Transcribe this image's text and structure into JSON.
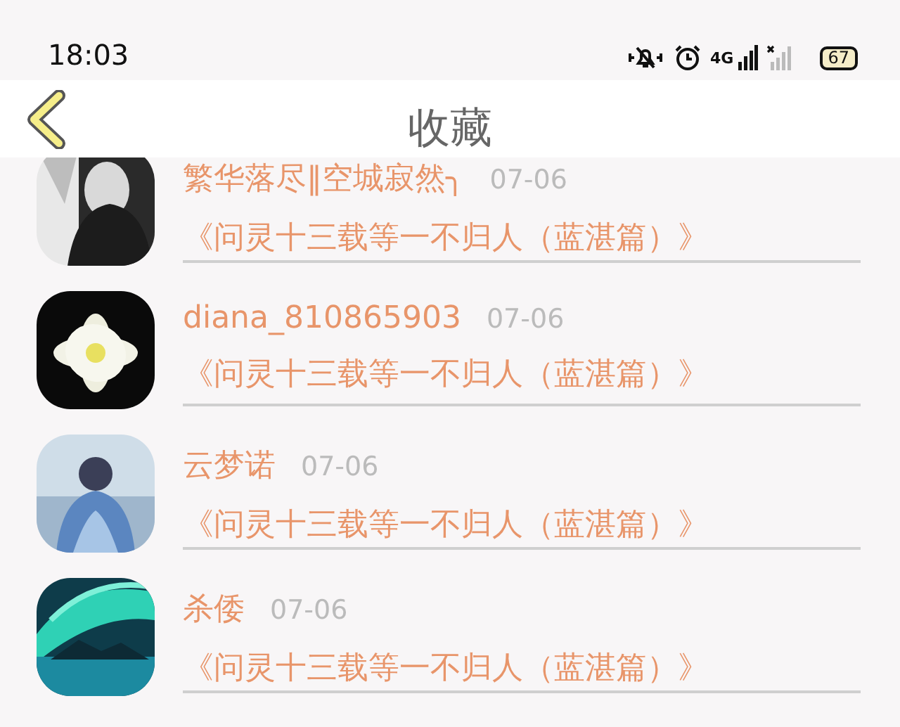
{
  "status_bar": {
    "time": "18:03",
    "network": "4G",
    "battery": "67"
  },
  "header": {
    "title": "收藏"
  },
  "items": [
    {
      "name": "繁华落尽‖空城寂然╮",
      "date": "07-06",
      "title": "《问灵十三载等一不归人（蓝湛篇）》"
    },
    {
      "name": "diana_810865903",
      "date": "07-06",
      "title": "《问灵十三载等一不归人（蓝湛篇）》"
    },
    {
      "name": "云梦诺",
      "date": "07-06",
      "title": "《问灵十三载等一不归人（蓝湛篇）》"
    },
    {
      "name": "杀倭",
      "date": "07-06",
      "title": "《问灵十三载等一不归人（蓝湛篇）》"
    }
  ]
}
